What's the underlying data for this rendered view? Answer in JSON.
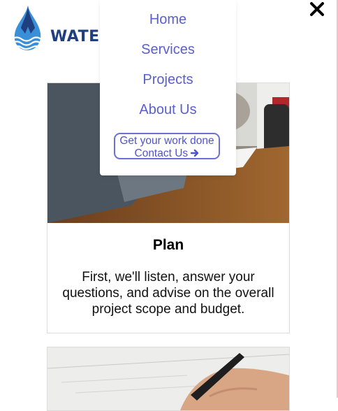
{
  "logo": {
    "text": "WATER"
  },
  "menu": {
    "items": [
      "Home",
      "Services",
      "Projects",
      "About Us"
    ],
    "cta_line1": "Get your work done",
    "cta_line2": "Contact Us",
    "cta_icon": "arrow-right-icon"
  },
  "close_icon": "close-icon",
  "cards": [
    {
      "title": "Plan",
      "text": "First, we'll listen, answer your questions, and advise on the overall project scope and budget."
    }
  ],
  "colors": {
    "link": "#5a5fd0",
    "brand_dark": "#1f3f7f",
    "brand_light": "#3b8fd9"
  }
}
